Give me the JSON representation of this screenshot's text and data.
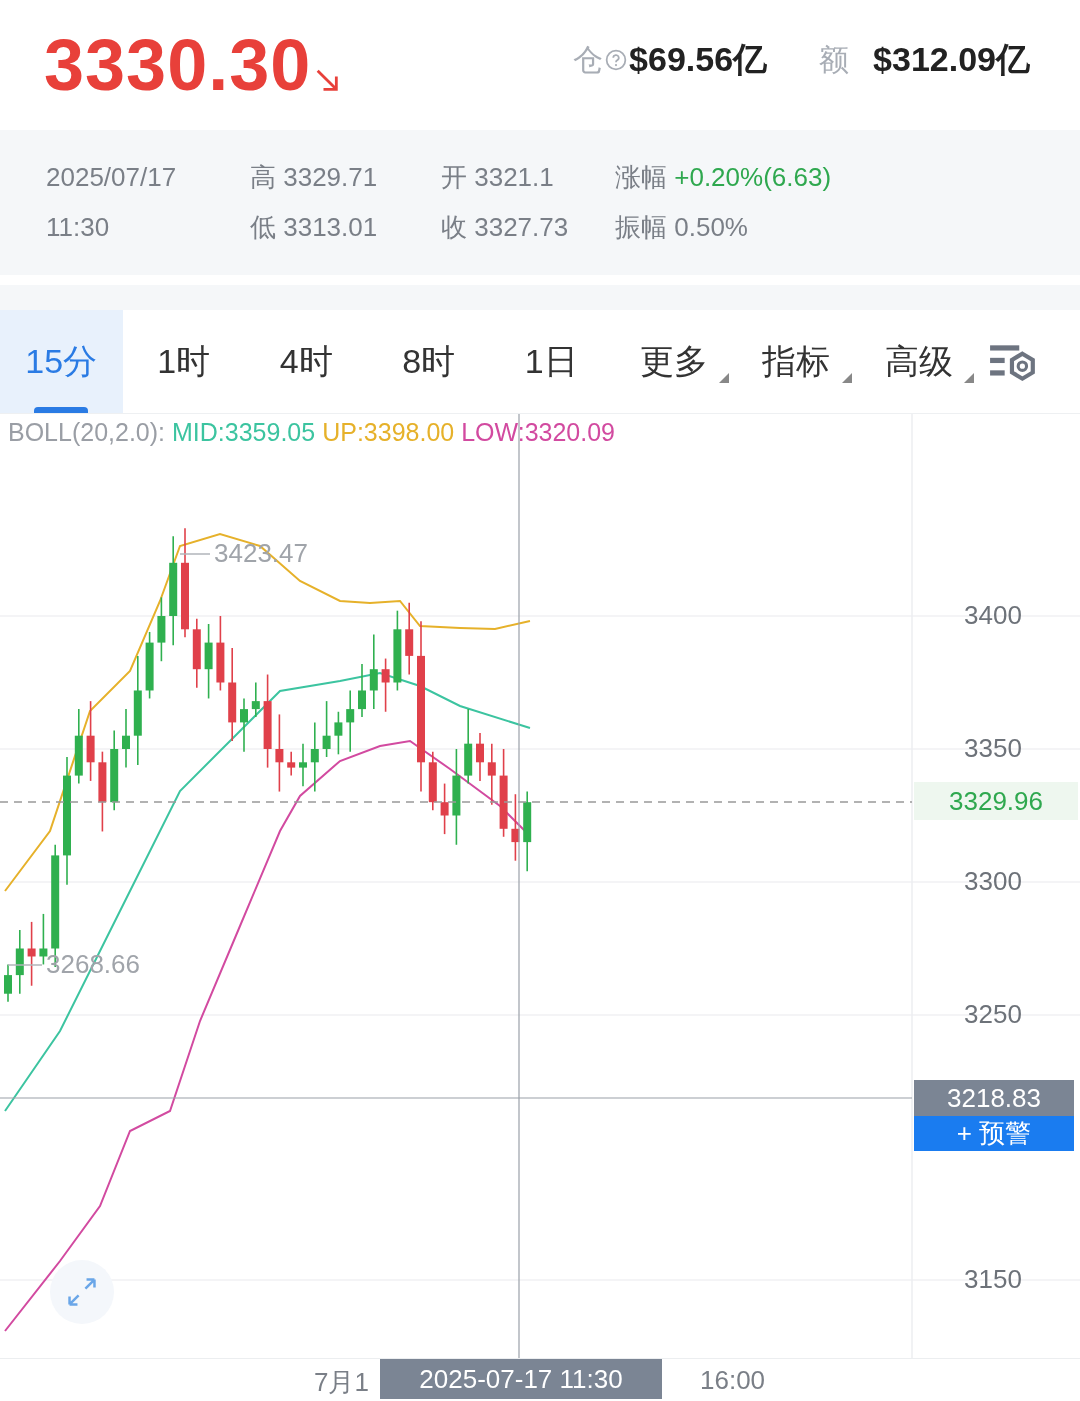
{
  "header": {
    "price": "3330.30",
    "stats": [
      {
        "label": "仓",
        "value": "$69.56亿",
        "help": true
      },
      {
        "label": "额",
        "value": "$312.09亿",
        "help": false
      }
    ]
  },
  "info": {
    "date": "2025/07/17",
    "time": "11:30",
    "cells": [
      {
        "label": "高",
        "value": "3329.71",
        "kind": "plain"
      },
      {
        "label": "低",
        "value": "3313.01",
        "kind": "plain"
      },
      {
        "label": "开",
        "value": "3321.1",
        "kind": "plain"
      },
      {
        "label": "收",
        "value": "3327.73",
        "kind": "plain"
      },
      {
        "label": "涨幅",
        "value": "+0.20%(6.63)",
        "kind": "up"
      },
      {
        "label": "振幅",
        "value": "0.50%",
        "kind": "plain"
      }
    ]
  },
  "tabs": [
    {
      "label": "15分",
      "selected": true,
      "dropdown": false
    },
    {
      "label": "1时",
      "selected": false,
      "dropdown": false
    },
    {
      "label": "4时",
      "selected": false,
      "dropdown": false
    },
    {
      "label": "8时",
      "selected": false,
      "dropdown": false
    },
    {
      "label": "1日",
      "selected": false,
      "dropdown": false
    },
    {
      "label": "更多",
      "selected": false,
      "dropdown": true
    },
    {
      "label": "指标",
      "selected": false,
      "dropdown": true
    },
    {
      "label": "高级",
      "selected": false,
      "dropdown": true
    }
  ],
  "indicator": {
    "name": "BOLL(20,2.0):",
    "lines": [
      {
        "label": "MID:3359.05",
        "color": "#3cc4a0"
      },
      {
        "label": "UP:3398.00",
        "color": "#e6b12a"
      },
      {
        "label": "LOW:3320.09",
        "color": "#d24aa0"
      }
    ]
  },
  "chart": {
    "y_labels": [
      "3400",
      "3350",
      "3300",
      "3250",
      "3150"
    ],
    "current_price": "3329.96",
    "crosshair": {
      "price": "3218.83",
      "time": "2025-07-17 11:30"
    },
    "alert_button": "+ 预警",
    "max_label": "3423.47",
    "min_label": "3268.66",
    "x_labels": [
      "7月1",
      "16:00"
    ]
  }
}
